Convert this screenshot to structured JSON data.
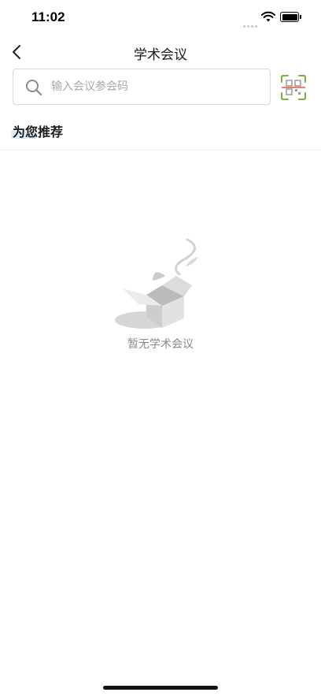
{
  "status_bar": {
    "time": "11:02"
  },
  "nav": {
    "title": "学术会议",
    "back_icon": "chevron-left-icon"
  },
  "search": {
    "placeholder": "输入会议参会码",
    "value": "",
    "icon": "search-icon"
  },
  "scan": {
    "icon": "qr-scan-icon",
    "accent_color": "#7bb23a",
    "line_color": "#e0593b"
  },
  "section": {
    "title": "为您推荐"
  },
  "empty_state": {
    "message": "暂无学术会议",
    "icon": "empty-box-icon"
  },
  "colors": {
    "highlight": "#dbeeff",
    "placeholder": "#a8a8a8",
    "empty_text": "#8a8a8a"
  }
}
